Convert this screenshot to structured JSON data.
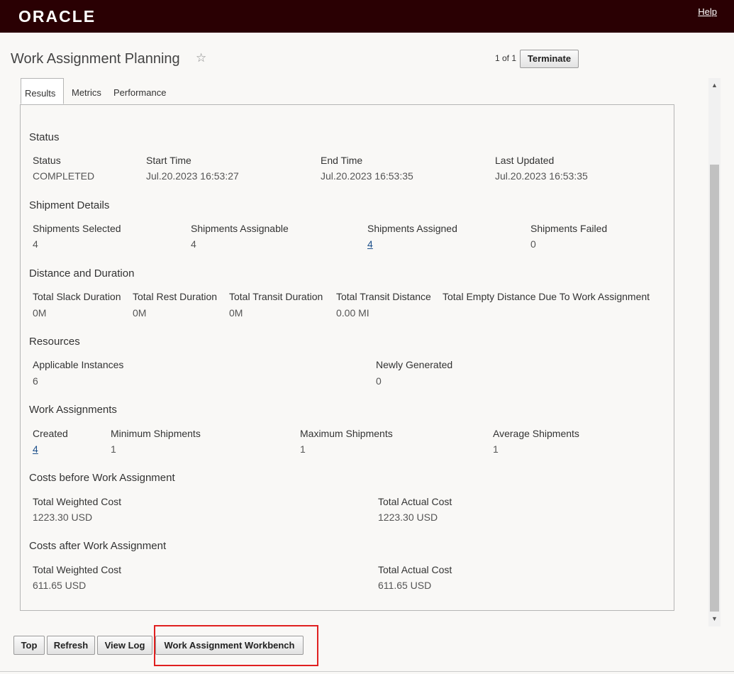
{
  "header": {
    "logo": "ORACLE",
    "help": "Help"
  },
  "page": {
    "title": "Work Assignment Planning",
    "pager": "1 of 1",
    "terminate": "Terminate"
  },
  "tabs": [
    "Results",
    "Metrics",
    "Performance"
  ],
  "status": {
    "title": "Status",
    "labels": [
      "Status",
      "Start Time",
      "End Time",
      "Last Updated"
    ],
    "values": [
      "COMPLETED",
      "Jul.20.2023 16:53:27",
      "Jul.20.2023 16:53:35",
      "Jul.20.2023 16:53:35"
    ]
  },
  "shipment": {
    "title": "Shipment Details",
    "labels": [
      "Shipments Selected",
      "Shipments Assignable",
      "Shipments Assigned",
      "Shipments Failed"
    ],
    "values": [
      "4",
      "4",
      "4",
      "0"
    ]
  },
  "distance": {
    "title": "Distance and Duration",
    "labels": [
      "Total Slack Duration",
      "Total Rest Duration",
      "Total Transit Duration",
      "Total Transit Distance",
      "Total Empty Distance Due To Work Assignment"
    ],
    "values": [
      "0M",
      "0M",
      "0M",
      "0.00 MI"
    ]
  },
  "resources": {
    "title": "Resources",
    "labels": [
      "Applicable Instances",
      "Newly Generated"
    ],
    "values": [
      "6",
      "0"
    ]
  },
  "work": {
    "title": "Work Assignments",
    "labels": [
      "Created",
      "Minimum Shipments",
      "Maximum Shipments",
      "Average Shipments"
    ],
    "values": [
      "4",
      "1",
      "1",
      "1"
    ]
  },
  "costs_before": {
    "title": "Costs before Work Assignment",
    "labels": [
      "Total Weighted Cost",
      "Total Actual Cost"
    ],
    "values": [
      "1223.30 USD",
      "1223.30 USD"
    ]
  },
  "costs_after": {
    "title": "Costs after Work Assignment",
    "labels": [
      "Total Weighted Cost",
      "Total Actual Cost"
    ],
    "values": [
      "611.65 USD",
      "611.65 USD"
    ]
  },
  "footer": {
    "top": "Top",
    "refresh": "Refresh",
    "view_log": "View Log",
    "workbench": "Work Assignment Workbench"
  },
  "colors": {
    "header_bg": "#2a0003",
    "link": "#1c4f8a",
    "highlight": "#e02020"
  }
}
